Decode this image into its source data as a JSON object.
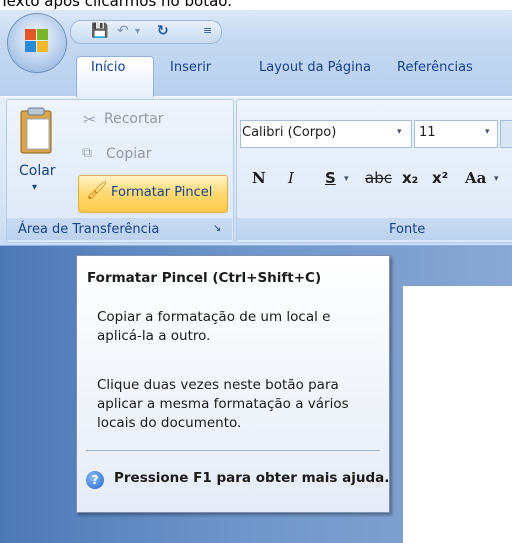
{
  "caption": "Texto após clicarmos no botão.",
  "tabs": [
    {
      "label": "Início",
      "active": true
    },
    {
      "label": "Inserir",
      "active": false
    },
    {
      "label": "Layout da Página",
      "active": false
    },
    {
      "label": "Referências",
      "active": false
    }
  ],
  "clipboard": {
    "paste_label": "Colar",
    "cut_label": "Recortar",
    "copy_label": "Copiar",
    "format_painter_label": "Formatar Pincel",
    "group_label": "Área de Transferência"
  },
  "font": {
    "font_name": "Calibri (Corpo)",
    "font_size": "11",
    "group_label": "Fonte",
    "buttons": [
      "N",
      "I",
      "S",
      "abc",
      "x₂",
      "x²",
      "Aa"
    ]
  },
  "tooltip": {
    "title": "Formatar Pincel (Ctrl+Shift+C)",
    "paragraph1": "Copiar a formatação de um local e aplicá-la a outro.",
    "paragraph2": "Clique duas vezes neste botão para aplicar a mesma formatação a vários locais do documento.",
    "help": "Pressione F1 para obter mais ajuda."
  },
  "colors": {
    "ribbon_text": "#15428b",
    "highlight": "#ffd970"
  }
}
